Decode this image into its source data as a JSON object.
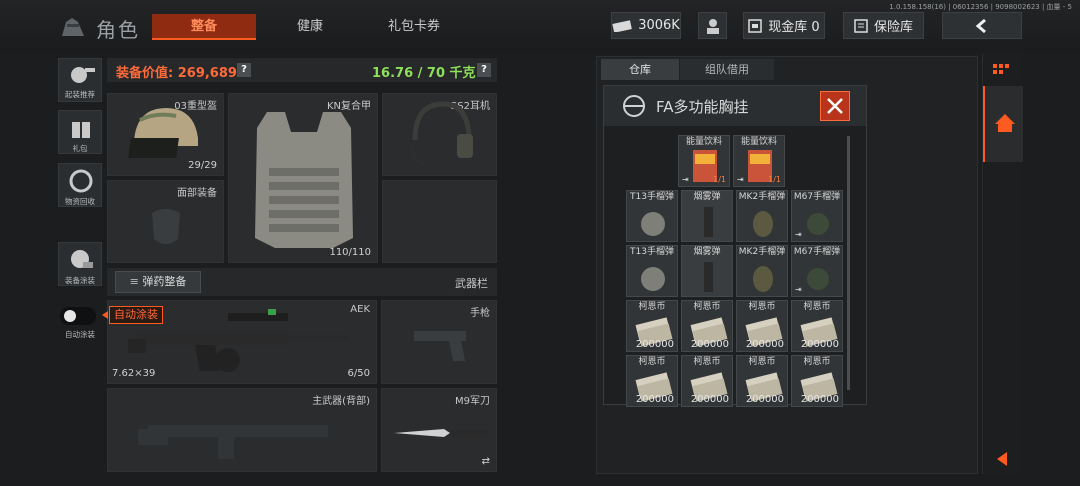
{
  "header": {
    "page_title": "角色",
    "tabs": [
      {
        "label": "整备",
        "active": true
      },
      {
        "label": "健康",
        "active": false
      },
      {
        "label": "礼包卡券",
        "active": false
      }
    ],
    "currency": "3006K",
    "cash_vault": "现金库 0",
    "insurance": "保险库",
    "version_info": "1.0.158.158(16) | 06012356 | 9098002623 | 血量 - 5"
  },
  "sidebar": {
    "items": [
      {
        "label": "起装推荐",
        "icon": "loadout-recommend-icon"
      },
      {
        "label": "礼包",
        "icon": "gift-icon"
      },
      {
        "label": "物资回收",
        "icon": "recycle-icon"
      },
      {
        "label": "装备涂装",
        "icon": "paint-icon"
      },
      {
        "label": "自动涂装",
        "icon": "toggle-icon"
      }
    ]
  },
  "loadout": {
    "value_label": "装备价值: 269,689",
    "weight": "16.76 / 70 千克",
    "help": "?",
    "helmet": {
      "name": "03重型盔",
      "durability": "29/29"
    },
    "armor": {
      "name": "KN复合甲",
      "durability": "110/110"
    },
    "headset": {
      "name": "GS2耳机"
    },
    "face": {
      "name": "面部装备"
    },
    "ammo_button": "弹药整备",
    "weapon_rail": "武器栏",
    "auto_paint_tag": "自动涂装",
    "primary": {
      "name": "AEK",
      "caliber": "7.62×39",
      "ammo": "6/50"
    },
    "pistol": {
      "name": "手枪"
    },
    "back_weapon": {
      "name": "主武器(背部)"
    },
    "knife": {
      "name": "M9军刀"
    }
  },
  "storage": {
    "tabs": [
      {
        "label": "仓库",
        "active": true
      },
      {
        "label": "组队借用",
        "active": false
      }
    ],
    "popup_title": "FA多功能胸挂",
    "items": [
      [
        {
          "label": "能量饮料",
          "sub": "1/1"
        },
        {
          "label": "能量饮料",
          "sub": "1/1"
        }
      ],
      [
        {
          "label": "T13手榴弹"
        },
        {
          "label": "烟雾弹"
        },
        {
          "label": "MK2手榴弹"
        },
        {
          "label": "M67手榴弹"
        }
      ],
      [
        {
          "label": "T13手榴弹"
        },
        {
          "label": "烟雾弹"
        },
        {
          "label": "MK2手榴弹"
        },
        {
          "label": "M67手榴弹"
        }
      ],
      [
        {
          "label": "柯恩币",
          "amount": "200000"
        },
        {
          "label": "柯恩币",
          "amount": "200000"
        },
        {
          "label": "柯恩币",
          "amount": "200000"
        },
        {
          "label": "柯恩币",
          "amount": "200000"
        }
      ],
      [
        {
          "label": "柯恩币",
          "amount": "200000"
        },
        {
          "label": "柯恩币",
          "amount": "200000"
        },
        {
          "label": "柯恩币",
          "amount": "200000"
        },
        {
          "label": "柯恩币",
          "amount": "200000"
        }
      ]
    ]
  },
  "colors": {
    "accent": "#ff5a1f",
    "value": "#ff6a3a",
    "weight": "#8ee05a"
  }
}
